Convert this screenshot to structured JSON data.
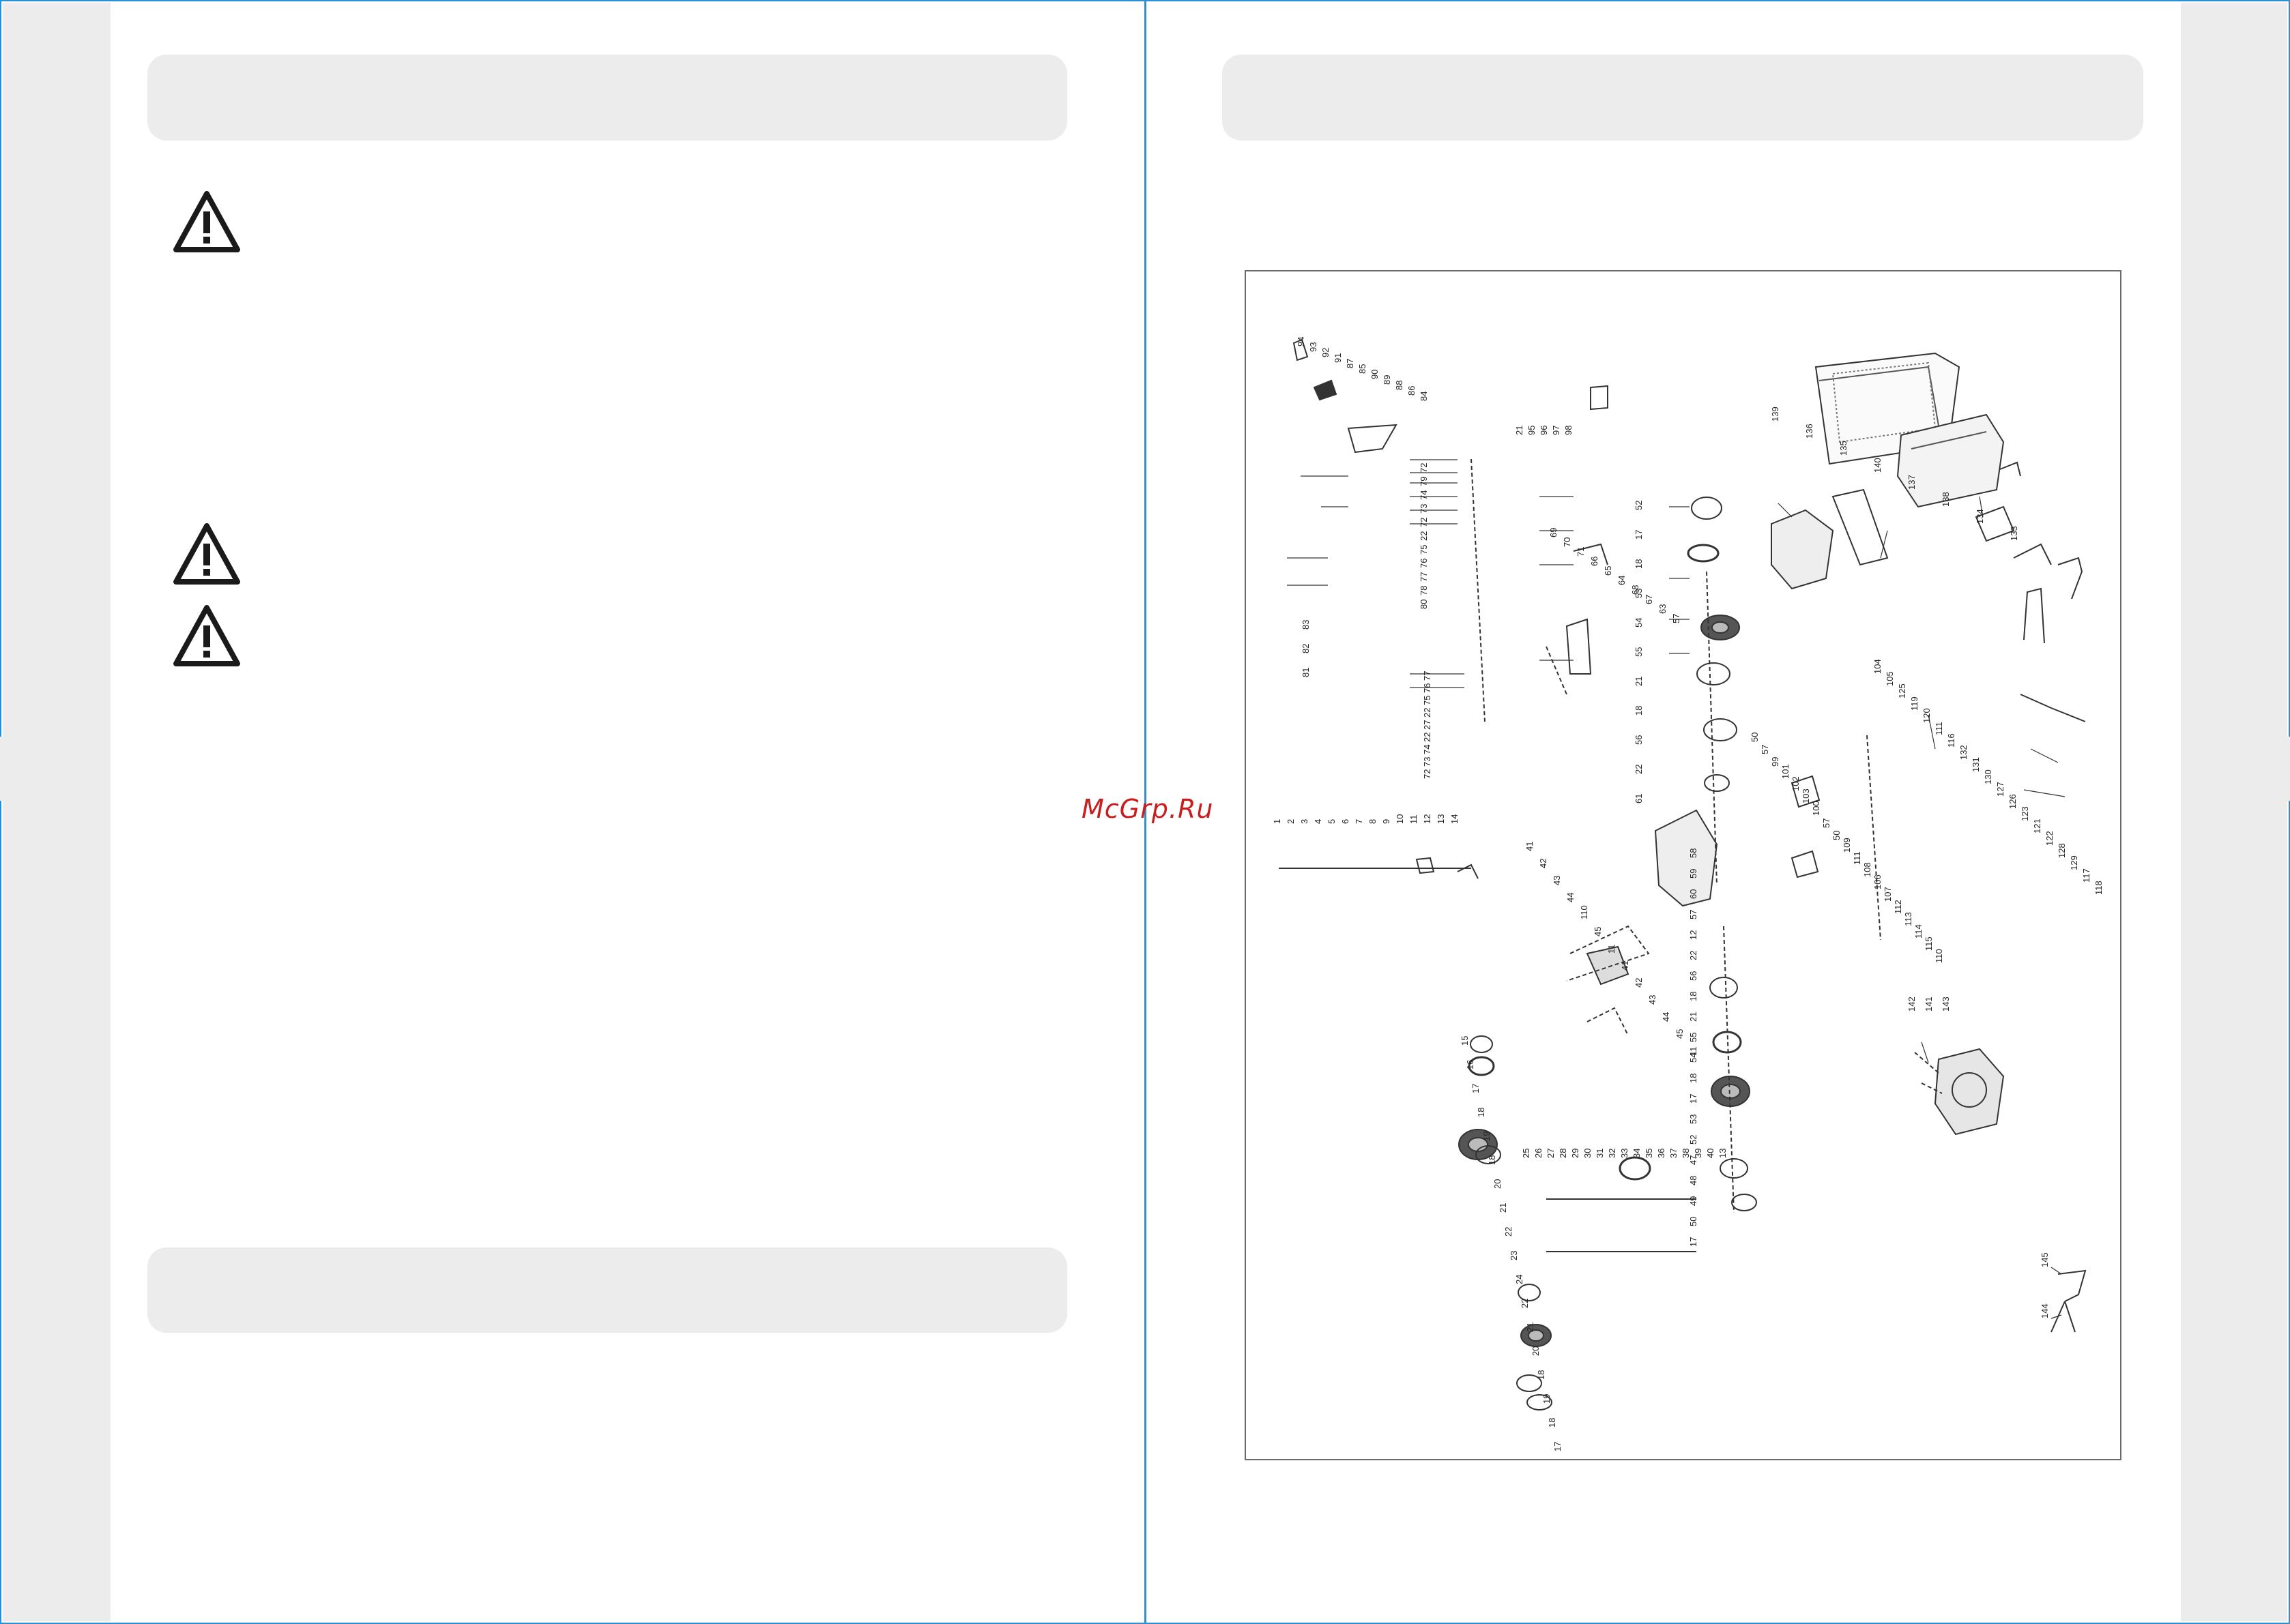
{
  "watermark": {
    "text": "McGrp.Ru",
    "color": "#c81e1e"
  },
  "colors": {
    "border": "#2b8fd6",
    "panel": "#ececec",
    "warning": "#1a1a1a"
  },
  "left_page": {
    "header": "",
    "warnings": [
      {
        "icon": "warning-triangle-icon",
        "text": ""
      },
      {
        "icon": "warning-triangle-icon",
        "text": ""
      },
      {
        "icon": "warning-triangle-icon",
        "text": ""
      }
    ],
    "footer_header": ""
  },
  "right_page": {
    "header": "",
    "diagram": {
      "part_labels_column_a": [
        "94",
        "93",
        "92",
        "91",
        "87",
        "85",
        "90",
        "89",
        "88",
        "86",
        "84"
      ],
      "part_labels_column_b": [
        "72",
        "79",
        "74",
        "73",
        "72",
        "22",
        "75",
        "76",
        "77",
        "78",
        "80"
      ],
      "part_labels_column_c": [
        "77",
        "76",
        "75",
        "22",
        "27",
        "22",
        "74",
        "73",
        "72"
      ],
      "part_labels_column_d": [
        "83",
        "82",
        "81"
      ],
      "part_labels_column_e": [
        "21",
        "95",
        "96",
        "97",
        "98"
      ],
      "part_labels_column_f": [
        "69",
        "70",
        "71",
        "66",
        "65",
        "64",
        "68",
        "67",
        "63",
        "57"
      ],
      "part_labels_column_g": [
        "52",
        "17",
        "18",
        "53",
        "54",
        "55",
        "21",
        "18",
        "56",
        "22",
        "61"
      ],
      "part_labels_column_h": [
        "139",
        "136",
        "135",
        "140",
        "137",
        "138",
        "134",
        "133"
      ],
      "part_labels_column_i": [
        "104",
        "105",
        "125",
        "119",
        "120",
        "111",
        "116",
        "132",
        "131",
        "130",
        "127",
        "126",
        "123",
        "121",
        "122",
        "128",
        "129",
        "117",
        "118"
      ],
      "part_labels_column_j": [
        "50",
        "57",
        "99",
        "101",
        "102",
        "103",
        "100",
        "57",
        "50",
        "109",
        "111",
        "108",
        "106",
        "107",
        "112",
        "113",
        "114",
        "115",
        "110"
      ],
      "part_labels_column_k": [
        "1",
        "2",
        "3",
        "4",
        "5",
        "6",
        "7",
        "8",
        "9",
        "10",
        "11",
        "12",
        "13",
        "14"
      ],
      "part_labels_column_l": [
        "41",
        "42",
        "43",
        "44",
        "110",
        "45",
        "11",
        "41",
        "42",
        "43",
        "44",
        "45",
        "11"
      ],
      "part_labels_column_m": [
        "58",
        "59",
        "60",
        "57",
        "12",
        "22",
        "56",
        "18",
        "21",
        "55",
        "54",
        "18",
        "17",
        "53",
        "52",
        "47",
        "48",
        "49",
        "50",
        "17"
      ],
      "part_labels_column_n": [
        "142",
        "141",
        "143"
      ],
      "part_labels_column_o": [
        "15",
        "16",
        "17",
        "18",
        "19",
        "18",
        "20",
        "21",
        "22",
        "23",
        "24",
        "22",
        "21",
        "20",
        "18",
        "19",
        "18",
        "17",
        "16",
        "15"
      ],
      "part_labels_column_p": [
        "25",
        "26",
        "27",
        "28",
        "29",
        "30",
        "31",
        "32",
        "33",
        "34",
        "35",
        "36",
        "37",
        "38",
        "39",
        "40",
        "13"
      ],
      "part_labels_column_q": [
        "145",
        "144"
      ]
    }
  },
  "footer_left_header": ""
}
